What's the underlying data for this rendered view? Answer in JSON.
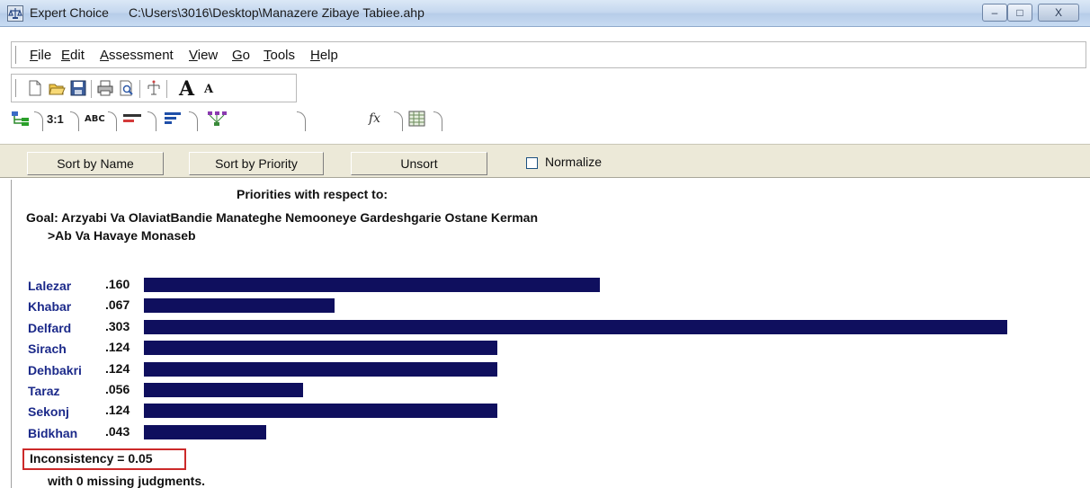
{
  "window": {
    "app_name": "Expert Choice",
    "file_path": "C:\\Users\\3016\\Desktop\\Manazere Zibaye Tabiee.ahp",
    "controls": {
      "minimize": "–",
      "maximize": "□",
      "close": "X"
    }
  },
  "menu": {
    "items": [
      {
        "label": "File",
        "mnemonic": "F"
      },
      {
        "label": "Edit",
        "mnemonic": "E"
      },
      {
        "label": "Assessment",
        "mnemonic": "A"
      },
      {
        "label": "View",
        "mnemonic": "V"
      },
      {
        "label": "Go",
        "mnemonic": "G"
      },
      {
        "label": "Tools",
        "mnemonic": "T"
      },
      {
        "label": "Help",
        "mnemonic": "H"
      }
    ]
  },
  "toolbar": {
    "icons": [
      "new-file-icon",
      "open-folder-icon",
      "save-icon",
      "print-icon",
      "print-preview-icon",
      "tree-icon",
      "font-increase-icon",
      "font-decrease-icon"
    ],
    "font_up_letter": "A",
    "font_down_letter": "A"
  },
  "mode_tabs": {
    "pairwise_label": "3:1",
    "verbal_label": "ABC",
    "formula_label": "fx"
  },
  "sort_bar": {
    "sort_by_name": "Sort by Name",
    "sort_by_priority": "Sort by Priority",
    "unsort": "Unsort",
    "normalize_label": "Normalize",
    "normalize_checked": false
  },
  "priorities": {
    "heading": "Priorities with respect to:",
    "goal": "Goal: Arzyabi Va OlaviatBandie Manateghe Nemooneye Gardeshgarie Ostane Kerman",
    "node": ">Ab Va Havaye Monaseb",
    "bar_color": "#0f0f5e",
    "name_color": "#1c2a8a",
    "items": [
      {
        "name": "Lalezar",
        "value": ".160",
        "priority": 0.16
      },
      {
        "name": "Khabar",
        "value": ".067",
        "priority": 0.067
      },
      {
        "name": "Delfard",
        "value": ".303",
        "priority": 0.303
      },
      {
        "name": "Sirach",
        "value": ".124",
        "priority": 0.124
      },
      {
        "name": "Dehbakri",
        "value": ".124",
        "priority": 0.124
      },
      {
        "name": "Taraz",
        "value": ".056",
        "priority": 0.056
      },
      {
        "name": "Sekonj",
        "value": ".124",
        "priority": 0.124
      },
      {
        "name": "Bidkhan",
        "value": ".043",
        "priority": 0.043
      }
    ],
    "inconsistency": "Inconsistency = 0.05",
    "highlight_color": "#cc2a2a",
    "missing": "with 0  missing judgments."
  }
}
